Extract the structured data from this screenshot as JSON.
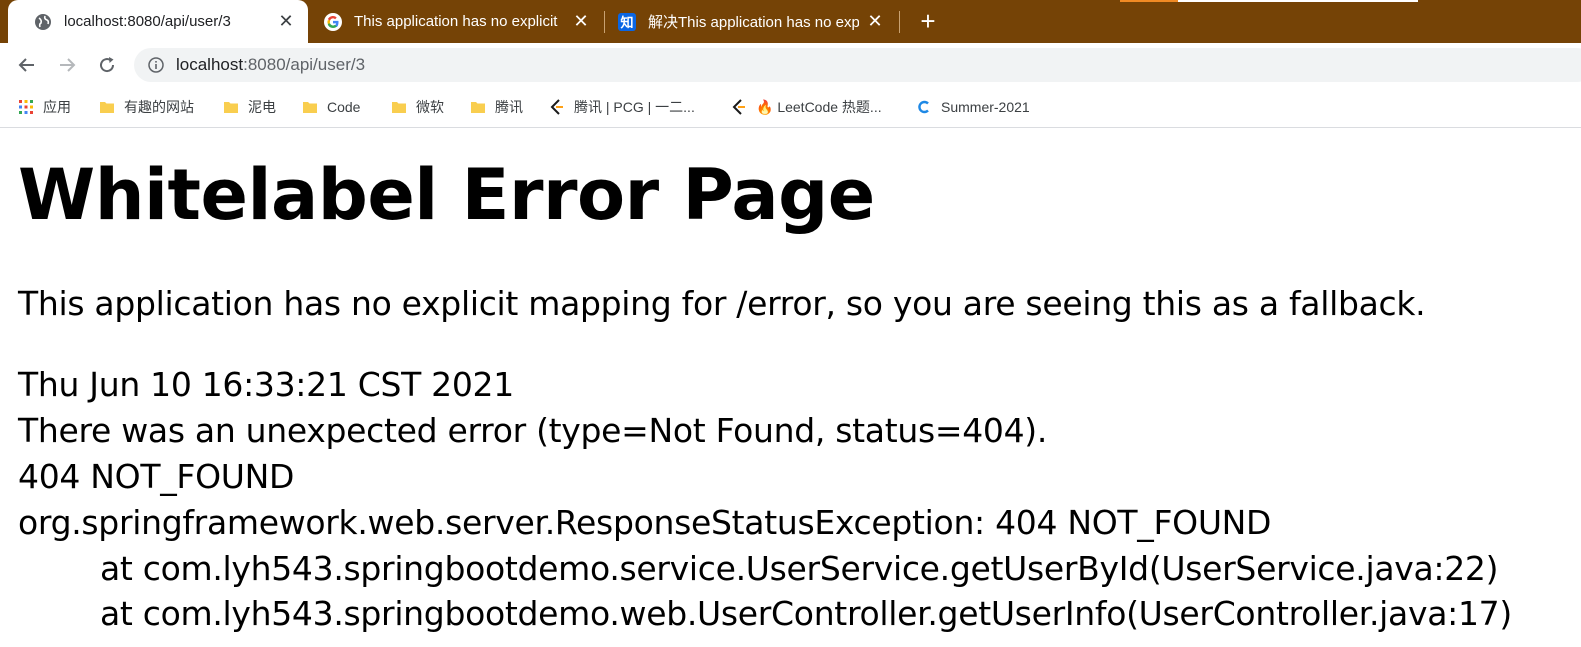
{
  "tabs": [
    {
      "title": "localhost:8080/api/user/3",
      "favicon": "globe-icon",
      "active": true
    },
    {
      "title": "This application has no explicit",
      "favicon": "google-icon",
      "active": false
    },
    {
      "title": "解决This application has no exp",
      "favicon": "zhihu-icon",
      "favicon_text": "知",
      "active": false
    }
  ],
  "new_tab_label": "+",
  "close_glyph": "✕",
  "toolbar": {
    "back": "back-arrow-icon",
    "forward": "forward-arrow-icon",
    "reload": "reload-icon",
    "url_host": "localhost",
    "url_rest": ":8080/api/user/3"
  },
  "bookmarks": [
    {
      "label": "应用",
      "icon": "apps-grid-icon"
    },
    {
      "label": "有趣的网站",
      "icon": "folder-icon"
    },
    {
      "label": "泥电",
      "icon": "folder-icon"
    },
    {
      "label": "Code",
      "icon": "folder-icon"
    },
    {
      "label": "微软",
      "icon": "folder-icon"
    },
    {
      "label": "腾讯",
      "icon": "folder-icon"
    },
    {
      "label": "腾讯 | PCG | 一二...",
      "icon": "leetcode-icon"
    },
    {
      "label": "🔥 LeetCode 热题...",
      "icon": "leetcode-icon"
    },
    {
      "label": "Summer-2021",
      "icon": "c-logo-icon"
    }
  ],
  "page": {
    "heading": "Whitelabel Error Page",
    "fallback": "This application has no explicit mapping for /error, so you are seeing this as a fallback.",
    "timestamp": "Thu Jun 10 16:33:21 CST 2021",
    "error_line": "There was an unexpected error (type=Not Found, status=404).",
    "status": "404 NOT_FOUND",
    "exception": "org.springframework.web.server.ResponseStatusException: 404 NOT_FOUND",
    "stack": [
      "at com.lyh543.springbootdemo.service.UserService.getUserById(UserService.java:22)",
      "at com.lyh543.springbootdemo.web.UserController.getUserInfo(UserController.java:17)"
    ]
  },
  "colors": {
    "tabstrip": "#754306",
    "omnibox": "#f1f3f4"
  }
}
